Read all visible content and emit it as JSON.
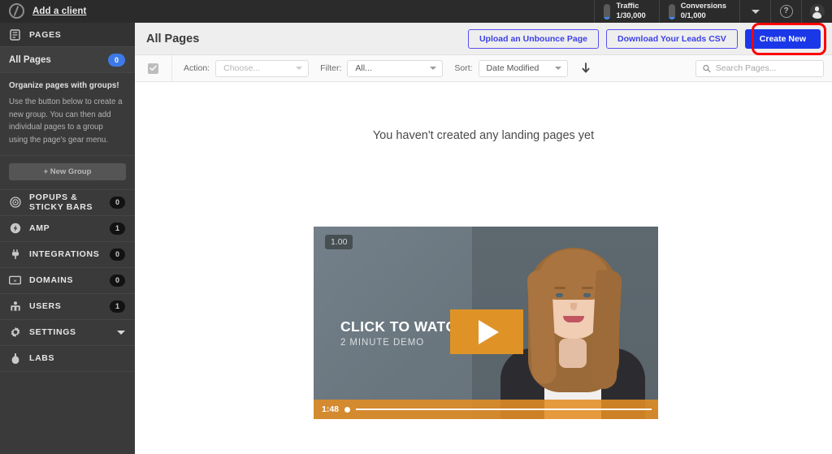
{
  "sidebar": {
    "logo_icon": "unbounce-logo-icon",
    "add_client": "Add a client",
    "section_pages": "PAGES",
    "all_pages": {
      "label": "All Pages",
      "badge": "0"
    },
    "help": {
      "title": "Organize pages with groups!",
      "body": "Use the button below to create a new group. You can then add individual pages to a group using the page's gear menu."
    },
    "new_group_label": "+ New Group",
    "items": [
      {
        "label": "POPUPS & STICKY BARS",
        "badge": "0",
        "icon": "target-icon"
      },
      {
        "label": "AMP",
        "badge": "1",
        "icon": "bolt-icon"
      },
      {
        "label": "INTEGRATIONS",
        "badge": "0",
        "icon": "plug-icon"
      },
      {
        "label": "DOMAINS",
        "badge": "0",
        "icon": "domain-icon"
      },
      {
        "label": "USERS",
        "badge": "1",
        "icon": "users-icon"
      },
      {
        "label": "SETTINGS",
        "badge": "",
        "icon": "gear-icon"
      },
      {
        "label": "LABS",
        "badge": "",
        "icon": "flask-icon"
      }
    ]
  },
  "topbar": {
    "traffic": {
      "label": "Traffic",
      "value": "1/30,000",
      "fill_percent": 14
    },
    "conversions": {
      "label": "Conversions",
      "value": "0/1,000",
      "fill_percent": 14
    },
    "caret_icon": "chevron-down-icon",
    "help_icon": "question-mark-icon",
    "avatar_icon": "user-avatar-icon"
  },
  "header": {
    "title": "All Pages",
    "upload_button": "Upload an Unbounce Page",
    "download_button": "Download Your Leads CSV",
    "create_button": "Create New",
    "highlight_color": "#ff0000",
    "primary_color": "#1b38e8"
  },
  "filterbar": {
    "select_all_icon": "checkmark-icon",
    "action_label": "Action:",
    "action_value": "Choose...",
    "filter_label": "Filter:",
    "filter_value": "All...",
    "sort_label": "Sort:",
    "sort_value": "Date Modified",
    "direction_icon": "arrow-down-icon",
    "search_icon": "search-icon",
    "search_placeholder": "Search Pages...",
    "search_value": ""
  },
  "content": {
    "empty_message": "You haven't created any landing pages yet",
    "video": {
      "speed_badge": "1.00",
      "cta_line1": "CLICK TO WATCH",
      "cta_line2": "2 MINUTE DEMO",
      "play_icon": "play-triangle-icon",
      "duration": "1:48",
      "accent_color": "#df9327"
    }
  }
}
